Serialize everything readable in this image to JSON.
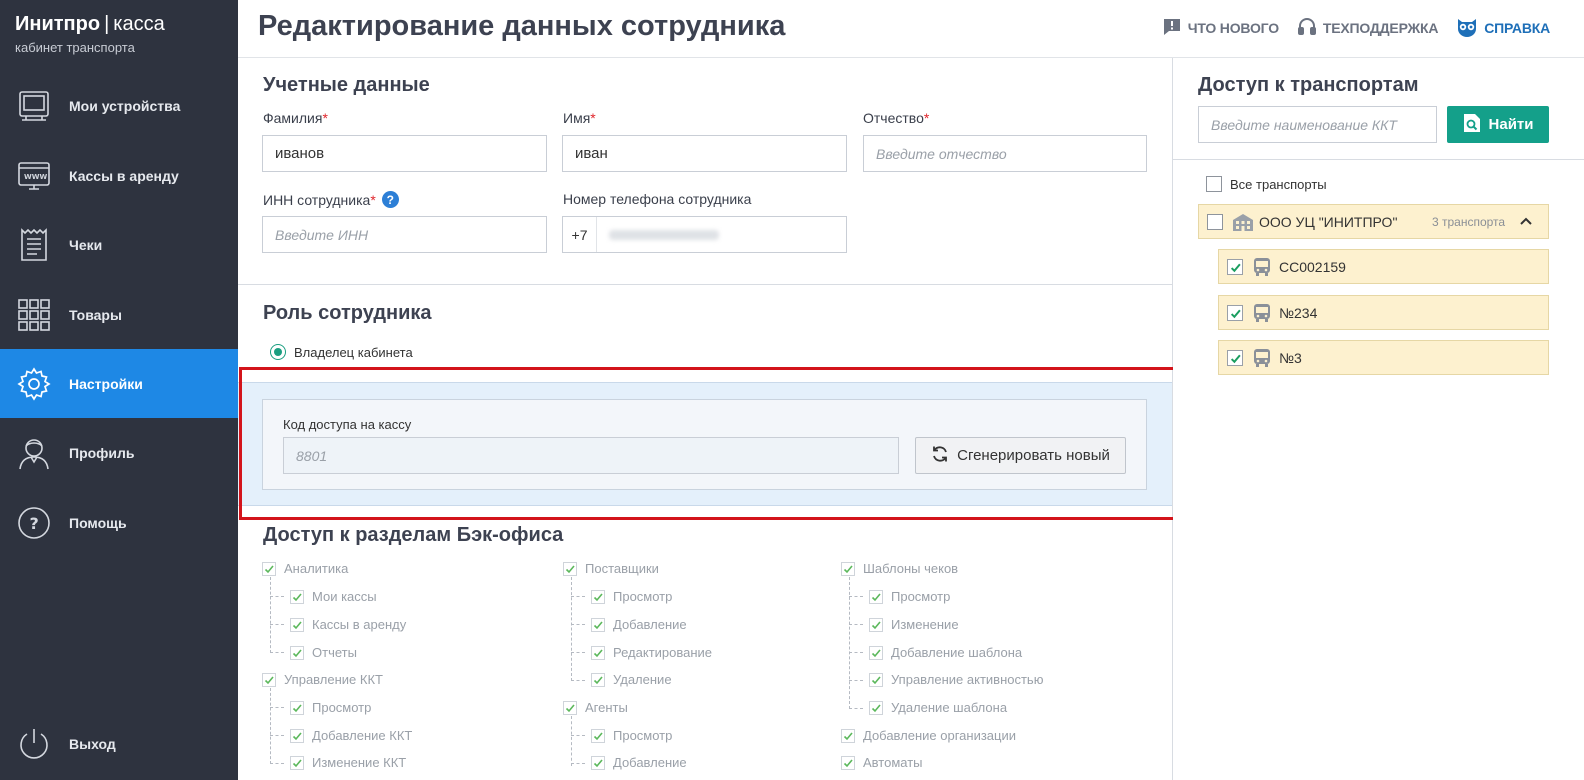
{
  "brand": {
    "name": "Инитпро",
    "separator": "|",
    "product": "касса",
    "subtitle": "кабинет транспорта"
  },
  "sidebar": {
    "items": [
      {
        "label": "Мои устройства",
        "icon": "device-icon"
      },
      {
        "label": "Кассы в аренду",
        "icon": "rent-register-icon"
      },
      {
        "label": "Чеки",
        "icon": "receipt-icon"
      },
      {
        "label": "Товары",
        "icon": "grid-icon"
      },
      {
        "label": "Настройки",
        "icon": "gear-icon",
        "active": true
      },
      {
        "label": "Профиль",
        "icon": "profile-icon"
      },
      {
        "label": "Помощь",
        "icon": "help-icon"
      }
    ],
    "logout": {
      "label": "Выход",
      "icon": "power-icon"
    }
  },
  "header": {
    "title": "Редактирование данных сотрудника",
    "links": {
      "news": "ЧТО НОВОГО",
      "support": "ТЕХПОДДЕРЖКА",
      "help": "СПРАВКА"
    }
  },
  "credentials": {
    "title": "Учетные данные",
    "last_name": {
      "label": "Фамилия",
      "value": "иванов"
    },
    "first_name": {
      "label": "Имя",
      "value": "иван"
    },
    "middle_name": {
      "label": "Отчество",
      "placeholder": "Введите отчество"
    },
    "inn": {
      "label": "ИНН сотрудника",
      "placeholder": "Введите ИНН"
    },
    "phone": {
      "label": "Номер телефона сотрудника",
      "prefix": "+7"
    },
    "required_mark": "*"
  },
  "role": {
    "title": "Роль сотрудника",
    "option": "Владелец кабинета",
    "code_label": "Код доступа на кассу",
    "code_value": "8801",
    "generate_label": "Сгенерировать новый"
  },
  "backoffice": {
    "title": "Доступ к разделам Бэк-офиса",
    "col1": {
      "analytics": "Аналитика",
      "my_kkt": "Мои кассы",
      "rent_kkt": "Кассы в аренду",
      "reports": "Отчеты",
      "kkt_mgmt": "Управление ККТ",
      "view": "Просмотр",
      "add_kkt": "Добавление ККТ",
      "edit_kkt": "Изменение ККТ"
    },
    "col2": {
      "suppliers": "Поставщики",
      "view": "Просмотр",
      "add": "Добавление",
      "edit": "Редактирование",
      "delete": "Удаление",
      "agents": "Агенты",
      "agents_view": "Просмотр",
      "agents_add": "Добавление"
    },
    "col3": {
      "templates": "Шаблоны чеков",
      "view": "Просмотр",
      "change": "Изменение",
      "add_tpl": "Добавление шаблона",
      "activity": "Управление активностью",
      "del_tpl": "Удаление шаблона",
      "add_org": "Добавление организации",
      "automats": "Автоматы"
    }
  },
  "transport": {
    "title": "Доступ к транспортам",
    "search_placeholder": "Введите наименование ККТ",
    "find_label": "Найти",
    "all_label": "Все транспорты",
    "org_name": "ООО УЦ \"ИНИТПРО\"",
    "org_count": "3 транспорта",
    "vehicles": [
      "СС002159",
      "№234",
      "№3"
    ]
  },
  "colors": {
    "sidebar": "#2e333f",
    "active": "#1e88e5",
    "accent": "#14a08a",
    "highlight": "#d3141b",
    "transport_row": "#fdf1cf"
  }
}
